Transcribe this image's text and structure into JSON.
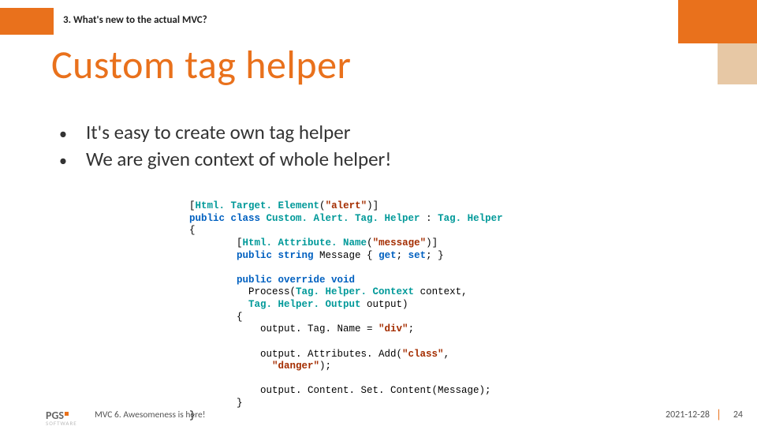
{
  "header": {
    "section_label": "3. What's new to the actual MVC?",
    "title": "Custom tag helper"
  },
  "bullets": [
    "It's easy to create own tag helper",
    "We are given context of whole helper!"
  ],
  "code": {
    "l1_a": "[",
    "l1_b": "Html. Target. Element",
    "l1_c": "(",
    "l1_d": "\"alert\"",
    "l1_e": ")]",
    "l2_a": "public class ",
    "l2_b": "Custom. Alert. Tag. Helper",
    "l2_c": " : ",
    "l2_d": "Tag. Helper",
    "l3": "{",
    "l4_a": "        [",
    "l4_b": "Html. Attribute. Name",
    "l4_c": "(",
    "l4_d": "\"message\"",
    "l4_e": ")]",
    "l5_a": "        public string ",
    "l5_b": "Message { ",
    "l5_c": "get",
    "l5_d": "; ",
    "l5_e": "set",
    "l5_f": "; }",
    "l6_a": "        public override void",
    "l6_b": "          Process(",
    "l6_c": "Tag. Helper. Context",
    "l6_d": " context,",
    "l6_e": "          ",
    "l6_f": "Tag. Helper. Output",
    "l6_g": " output)",
    "l7": "        {",
    "l8_a": "            output. Tag. Name = ",
    "l8_b": "\"div\"",
    "l8_c": ";",
    "l9_a": "            output. Attributes. Add(",
    "l9_b": "\"class\"",
    "l9_c": ",",
    "l9_d": "              ",
    "l9_e": "\"danger\"",
    "l9_f": ");",
    "l10": "            output. Content. Set. Content(Message);",
    "l11": "        }",
    "l12": "}"
  },
  "footer": {
    "logo_text": "PGS",
    "logo_sub": "SOFTWARE",
    "caption": "MVC 6. Awesomeness is here!",
    "date": "2021-12-28",
    "page": "24"
  }
}
